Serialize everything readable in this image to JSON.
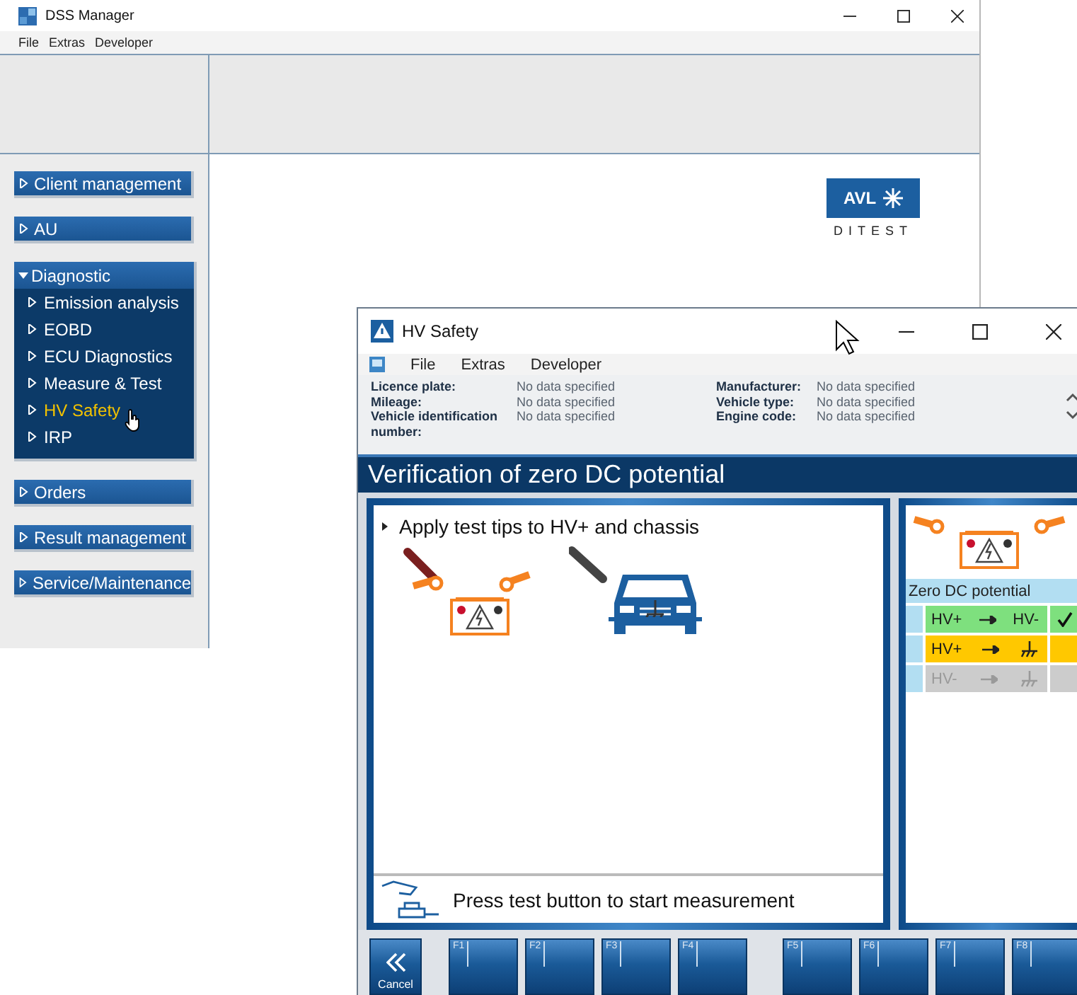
{
  "back_window": {
    "title": "DSS Manager",
    "menu": [
      "File",
      "Extras",
      "Developer"
    ],
    "sidebar": [
      {
        "label": "Client management",
        "expanded": false
      },
      {
        "label": "AU",
        "expanded": false
      },
      {
        "label": "Diagnostic",
        "expanded": true,
        "children": [
          {
            "label": "Emission analysis",
            "selected": false
          },
          {
            "label": "EOBD",
            "selected": false
          },
          {
            "label": "ECU Diagnostics",
            "selected": false
          },
          {
            "label": "Measure & Test",
            "selected": false
          },
          {
            "label": "HV Safety",
            "selected": true
          },
          {
            "label": "IRP",
            "selected": false
          }
        ]
      },
      {
        "label": "Orders",
        "expanded": false
      },
      {
        "label": "Result management",
        "expanded": false
      },
      {
        "label": "Service/Maintenance",
        "expanded": false
      }
    ],
    "logo": {
      "brand": "AVL",
      "tagline": "DITEST"
    }
  },
  "front_window": {
    "title": "HV Safety",
    "menu": [
      "File",
      "Extras",
      "Developer"
    ],
    "vehicle_info": [
      {
        "label": "Licence plate:",
        "value": "No data specified"
      },
      {
        "label": "Manufacturer:",
        "value": "No data specified"
      },
      {
        "label": "Mileage:",
        "value": "No data specified"
      },
      {
        "label": "Vehicle type:",
        "value": "No data specified"
      },
      {
        "label": "Vehicle identification number:",
        "value": "No data specified"
      },
      {
        "label": "Engine code:",
        "value": "No data specified"
      }
    ],
    "step_title": "Verification of zero DC potential",
    "instruction": "Apply test tips to HV+ and chassis",
    "prompt": "Press test button to start measurement",
    "result_panel": {
      "title": "Zero DC potential",
      "rows": [
        {
          "from": "HV+",
          "to": {
            "kind": "label",
            "text": "HV-"
          },
          "color": "#7ee07e",
          "checked": true,
          "disabled": false
        },
        {
          "from": "HV+",
          "to": {
            "kind": "ground"
          },
          "color": "#ffc800",
          "checked": false,
          "disabled": false
        },
        {
          "from": "HV-",
          "to": {
            "kind": "ground"
          },
          "color": "#cccccc",
          "checked": false,
          "disabled": true
        }
      ]
    },
    "toolbar": {
      "cancel": "Cancel",
      "function_keys": [
        "F1",
        "F2",
        "F3",
        "F4",
        "F5",
        "F6",
        "F7",
        "F8"
      ]
    }
  }
}
